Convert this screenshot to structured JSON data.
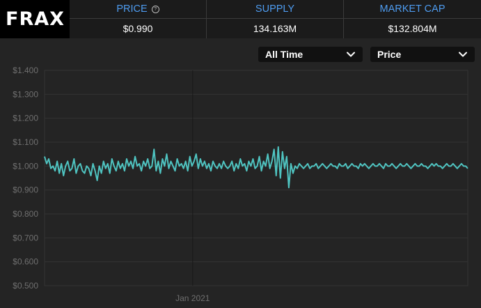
{
  "brand": {
    "logo_text": "FRAX"
  },
  "stats": [
    {
      "label": "PRICE",
      "value": "$0.990",
      "help_icon": "question-circle-icon"
    },
    {
      "label": "SUPPLY",
      "value": "134.163M"
    },
    {
      "label": "MARKET CAP",
      "value": "$132.804M"
    }
  ],
  "controls": {
    "range_select": {
      "value": "All Time",
      "icon": "chevron-down-icon"
    },
    "metric_select": {
      "value": "Price",
      "icon": "chevron-down-icon"
    }
  },
  "colors": {
    "accent": "#4e9cf0",
    "line": "#4fc4c1",
    "background": "#242424"
  },
  "chart_data": {
    "type": "line",
    "title": "",
    "xlabel": "",
    "ylabel": "",
    "ylim": [
      0.5,
      1.4
    ],
    "y_ticks": [
      "$0.500",
      "$0.600",
      "$0.700",
      "$0.800",
      "$0.900",
      "$1.000",
      "$1.100",
      "$1.200",
      "$1.300",
      "$1.400"
    ],
    "x_ticks": [
      {
        "label": "Jan 2021",
        "x": 0.35
      }
    ],
    "grid": true,
    "legend": "none",
    "series": [
      {
        "values": [
          1.04,
          1.01,
          1.03,
          0.99,
          1.0,
          0.98,
          1.02,
          0.97,
          1.01,
          0.96,
          1.0,
          1.02,
          0.98,
          0.99,
          1.03,
          0.97,
          1.0,
          1.01,
          0.98,
          0.97,
          1.0,
          0.99,
          0.96,
          1.01,
          0.98,
          0.94,
          1.0,
          0.97,
          1.02,
          0.99,
          1.01,
          0.97,
          1.03,
          1.0,
          0.98,
          1.02,
          0.99,
          1.01,
          0.98,
          1.03,
          1.0,
          1.02,
          0.99,
          1.04,
          1.0,
          1.01,
          0.98,
          1.02,
          1.0,
          1.03,
          0.99,
          1.0,
          1.07,
          0.98,
          1.02,
          0.97,
          1.03,
          1.0,
          1.05,
          0.99,
          1.02,
          1.0,
          0.98,
          1.03,
          1.0,
          1.01,
          0.99,
          1.02,
          0.98,
          1.04,
          1.0,
          1.02,
          1.05,
          0.99,
          1.03,
          1.0,
          1.02,
          0.99,
          1.01,
          0.98,
          1.02,
          1.0,
          0.99,
          1.01,
          0.99,
          1.02,
          1.0,
          0.99,
          1.0,
          1.02,
          0.98,
          1.01,
          0.99,
          1.03,
          1.0,
          1.01,
          0.98,
          1.02,
          1.0,
          1.03,
          0.99,
          1.0,
          1.04,
          0.98,
          1.02,
          1.0,
          1.05,
          0.99,
          1.02,
          1.07,
          0.96,
          1.08,
          0.95,
          1.06,
          0.99,
          1.04,
          0.91,
          1.01,
          0.97,
          1.0,
          0.99,
          1.01,
          1.0,
          0.99,
          1.0,
          1.01,
          0.99,
          1.0,
          1.0,
          1.01,
          0.99,
          1.0,
          1.01,
          1.0,
          0.99,
          1.0,
          1.01,
          1.0,
          1.0,
          0.99,
          1.01,
          1.0,
          1.0,
          1.01,
          0.99,
          1.0,
          1.01,
          1.0,
          1.0,
          0.99,
          1.01,
          1.0,
          1.01,
          1.0,
          0.99,
          1.0,
          1.01,
          1.0,
          1.0,
          1.01,
          1.0,
          0.99,
          1.01,
          1.0,
          1.0,
          1.01,
          1.0,
          0.99,
          1.0,
          1.01,
          1.0,
          1.0,
          1.01,
          1.0,
          0.99,
          1.0,
          1.01,
          1.0,
          1.0,
          1.01,
          1.0,
          1.0,
          0.99,
          1.0,
          1.01,
          1.0,
          1.01,
          1.0,
          1.0,
          0.99,
          1.0,
          1.01,
          1.0,
          1.0,
          1.01,
          1.0,
          0.99,
          1.0,
          1.01,
          1.0,
          1.0,
          0.99
        ]
      }
    ]
  }
}
